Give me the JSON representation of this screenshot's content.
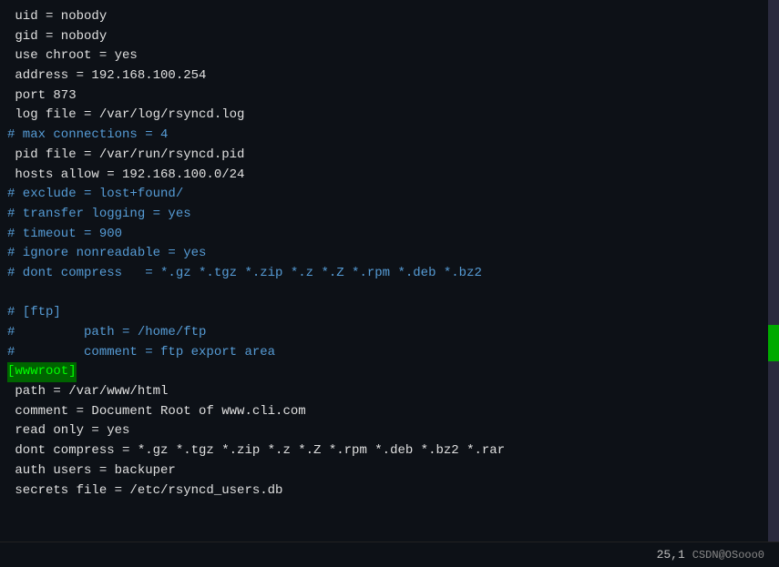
{
  "editor": {
    "background": "#0d1117",
    "lines": [
      {
        "type": "white",
        "content": " uid = nobody"
      },
      {
        "type": "white",
        "content": " gid = nobody"
      },
      {
        "type": "white",
        "content": " use chroot = yes"
      },
      {
        "type": "white",
        "content": " address = 192.168.100.254"
      },
      {
        "type": "white",
        "content": " port 873"
      },
      {
        "type": "white",
        "content": " log file = /var/log/rsyncd.log"
      },
      {
        "type": "comment",
        "content": "# max connections = 4"
      },
      {
        "type": "white",
        "content": " pid file = /var/run/rsyncd.pid"
      },
      {
        "type": "white",
        "content": " hosts allow = 192.168.100.0/24"
      },
      {
        "type": "comment",
        "content": "# exclude = lost+found/"
      },
      {
        "type": "comment",
        "content": "# transfer logging = yes"
      },
      {
        "type": "comment",
        "content": "# timeout = 900"
      },
      {
        "type": "comment",
        "content": "# ignore nonreadable = yes"
      },
      {
        "type": "comment",
        "content": "# dont compress   = *.gz *.tgz *.zip *.z *.Z *.rpm *.deb *.bz2"
      },
      {
        "type": "empty",
        "content": ""
      },
      {
        "type": "comment",
        "content": "# [ftp]"
      },
      {
        "type": "comment",
        "content": "#         path = /home/ftp"
      },
      {
        "type": "comment",
        "content": "#         comment = ftp export area"
      },
      {
        "type": "bracket",
        "content": "[wwwroot]"
      },
      {
        "type": "white",
        "content": " path = /var/www/html"
      },
      {
        "type": "white",
        "content": " comment = Document Root of www.cli.com"
      },
      {
        "type": "white",
        "content": " read only = yes"
      },
      {
        "type": "white",
        "content": " dont compress = *.gz *.tgz *.zip *.z *.Z *.rpm *.deb *.bz2 *.rar"
      },
      {
        "type": "white",
        "content": " auth users = backuper"
      },
      {
        "type": "white",
        "content": " secrets file = /etc/rsyncd_users.db"
      }
    ],
    "status": {
      "position": "25,1",
      "watermark": "CSDN@OSooo0"
    }
  }
}
